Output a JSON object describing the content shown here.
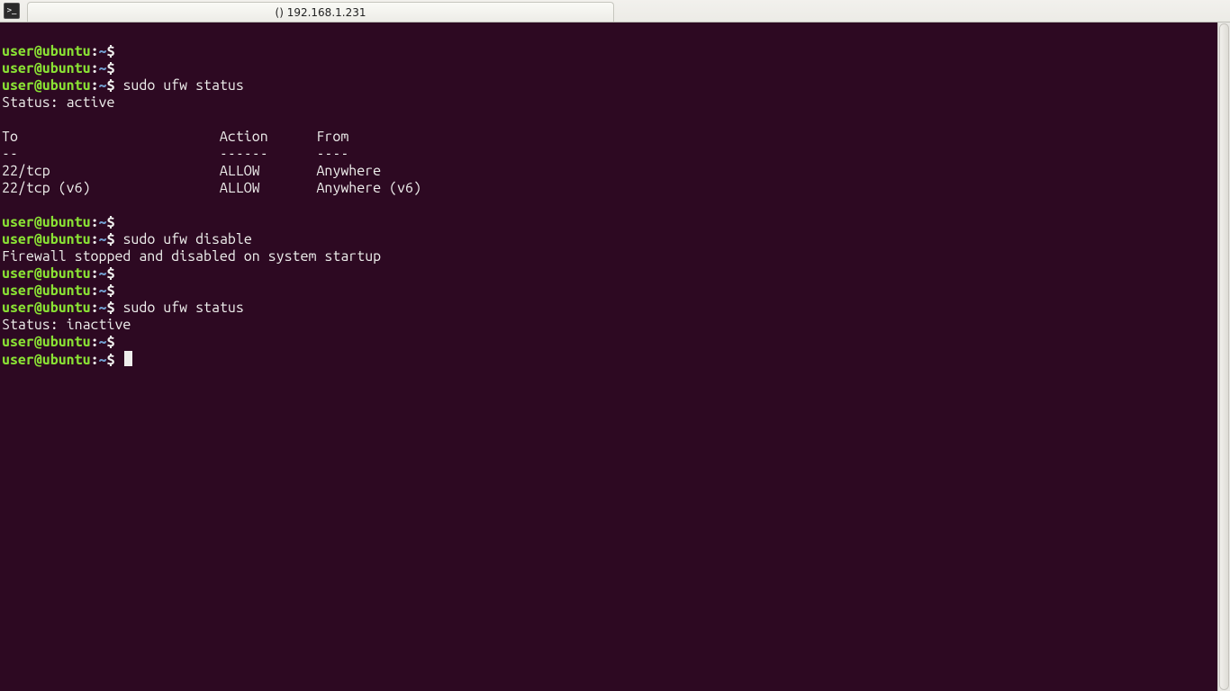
{
  "window": {
    "title": "() 192.168.1.231"
  },
  "prompt": {
    "userhost": "user@ubuntu",
    "sep1": ":",
    "path": "~",
    "sep2": "$"
  },
  "lines": {
    "cmd1": "",
    "cmd2": "",
    "cmd3": "sudo ufw status",
    "out3a": "Status: active",
    "out3b": "",
    "out3c": "To                         Action      From",
    "out3d": "--                         ------      ----",
    "out3e": "22/tcp                     ALLOW       Anywhere",
    "out3f": "22/tcp (v6)                ALLOW       Anywhere (v6)",
    "out3g": "",
    "cmd4": "",
    "cmd5": "sudo ufw disable",
    "out5a": "Firewall stopped and disabled on system startup",
    "cmd6": "",
    "cmd7": "",
    "cmd8": "sudo ufw status",
    "out8a": "Status: inactive",
    "cmd9": "",
    "cmd10": ""
  }
}
